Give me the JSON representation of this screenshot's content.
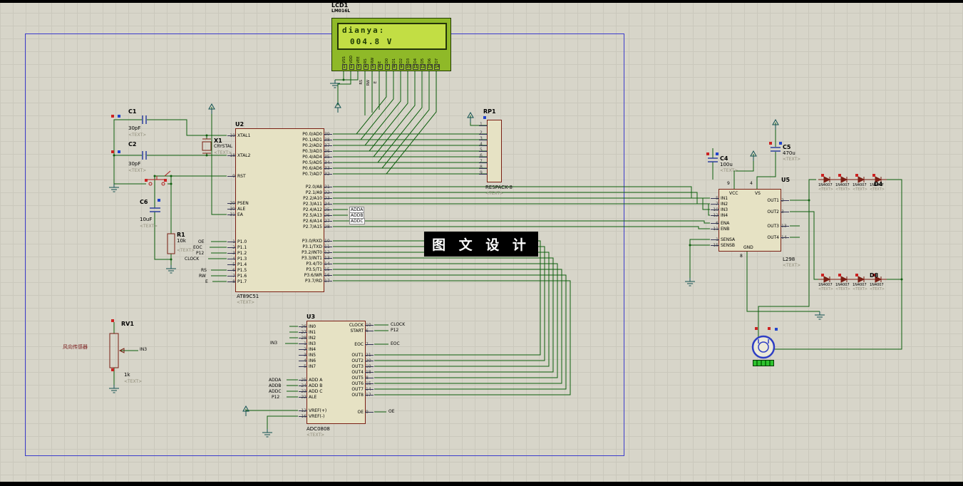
{
  "colors": {
    "wire": "#0d5e0d",
    "chip_fill": "#e6e2c4",
    "chip_border": "#7a1f14",
    "sheet_border": "#3c3ccc",
    "lcd_body": "#8fb928",
    "lcd_screen": "#c2de44",
    "lcd_text": "#1d3a04",
    "watermark_bg": "#000000",
    "watermark_text": "#ffffff",
    "sensor_text": "#7a1a1a",
    "readout": "#2ec22e"
  },
  "watermark": "图 文 设 计",
  "sensor_label": "风向传感器",
  "lcd": {
    "ref": "LCD1",
    "model": "LM016L",
    "line1": "dianya:",
    "line2": "004.8 V",
    "pins": [
      {
        "num": "1",
        "name": "VSS"
      },
      {
        "num": "2",
        "name": "VDD"
      },
      {
        "num": "3",
        "name": "VEE"
      },
      {
        "num": "4",
        "name": "RS"
      },
      {
        "num": "5",
        "name": "RW"
      },
      {
        "num": "6",
        "name": "E"
      },
      {
        "num": "7",
        "name": "D0"
      },
      {
        "num": "8",
        "name": "D1"
      },
      {
        "num": "9",
        "name": "D2"
      },
      {
        "num": "10",
        "name": "D3"
      },
      {
        "num": "11",
        "name": "D4"
      },
      {
        "num": "12",
        "name": "D5"
      },
      {
        "num": "13",
        "name": "D6"
      },
      {
        "num": "14",
        "name": "D7"
      }
    ]
  },
  "u2": {
    "ref": "U2",
    "value": "AT89C51",
    "ph": "<TEXT>",
    "g_xtal1": [
      {
        "num": "19",
        "name": "XTAL1"
      }
    ],
    "g_xtal2": [
      {
        "num": "18",
        "name": "XTAL2"
      }
    ],
    "g_rst": [
      {
        "num": "9",
        "name": "RST"
      }
    ],
    "g_ctrl": [
      {
        "num": "29",
        "name": "PSEN"
      },
      {
        "num": "30",
        "name": "ALE"
      },
      {
        "num": "31",
        "name": "EA"
      }
    ],
    "g_p1": [
      {
        "num": "1",
        "name": "P1.0"
      },
      {
        "num": "2",
        "name": "P1.1"
      },
      {
        "num": "3",
        "name": "P1.2"
      },
      {
        "num": "4",
        "name": "P1.3"
      },
      {
        "num": "5",
        "name": "P1.4"
      },
      {
        "num": "6",
        "name": "P1.5"
      },
      {
        "num": "7",
        "name": "P1.6"
      },
      {
        "num": "8",
        "name": "P1.7"
      }
    ],
    "g_p0": [
      {
        "num": "39",
        "name": "P0.0/AD0"
      },
      {
        "num": "38",
        "name": "P0.1/AD1"
      },
      {
        "num": "37",
        "name": "P0.2/AD2"
      },
      {
        "num": "36",
        "name": "P0.3/AD3"
      },
      {
        "num": "35",
        "name": "P0.4/AD4"
      },
      {
        "num": "34",
        "name": "P0.5/AD5"
      },
      {
        "num": "33",
        "name": "P0.6/AD6"
      },
      {
        "num": "32",
        "name": "P0.7/AD7"
      }
    ],
    "g_p2": [
      {
        "num": "21",
        "name": "P2.0/A8"
      },
      {
        "num": "22",
        "name": "P2.1/A9"
      },
      {
        "num": "23",
        "name": "P2.2/A10"
      },
      {
        "num": "24",
        "name": "P2.3/A11"
      },
      {
        "num": "25",
        "name": "P2.4/A12"
      },
      {
        "num": "26",
        "name": "P2.5/A13"
      },
      {
        "num": "27",
        "name": "P2.6/A14"
      },
      {
        "num": "28",
        "name": "P2.7/A15"
      }
    ],
    "g_p3": [
      {
        "num": "10",
        "name": "P3.0/RXD"
      },
      {
        "num": "11",
        "name": "P3.1/TXD"
      },
      {
        "num": "12",
        "name": "P3.2/INT0"
      },
      {
        "num": "13",
        "name": "P3.3/INT1"
      },
      {
        "num": "14",
        "name": "P3.4/T0"
      },
      {
        "num": "15",
        "name": "P3.5/T1"
      },
      {
        "num": "16",
        "name": "P3.6/WR"
      },
      {
        "num": "17",
        "name": "P3.7/RD"
      }
    ]
  },
  "u3": {
    "ref": "U3",
    "value": "ADC0808",
    "ph": "<TEXT>",
    "g_in": [
      {
        "num": "26",
        "name": "IN0"
      },
      {
        "num": "27",
        "name": "IN1"
      },
      {
        "num": "28",
        "name": "IN2"
      },
      {
        "num": "1",
        "name": "IN3"
      },
      {
        "num": "2",
        "name": "IN4"
      },
      {
        "num": "3",
        "name": "IN5"
      },
      {
        "num": "4",
        "name": "IN6"
      },
      {
        "num": "5",
        "name": "IN7"
      }
    ],
    "g_addr": [
      {
        "num": "25",
        "name": "ADD A"
      },
      {
        "num": "24",
        "name": "ADD B"
      },
      {
        "num": "23",
        "name": "ADD C"
      },
      {
        "num": "22",
        "name": "ALE"
      }
    ],
    "g_vref": [
      {
        "num": "12",
        "name": "VREF(+)"
      },
      {
        "num": "16",
        "name": "VREF(-)"
      }
    ],
    "g_clk": [
      {
        "num": "10",
        "name": "CLOCK"
      },
      {
        "num": "6",
        "name": "START"
      }
    ],
    "g_eoc": [
      {
        "num": "7",
        "name": "EOC"
      }
    ],
    "g_out": [
      {
        "num": "21",
        "name": "OUT1"
      },
      {
        "num": "20",
        "name": "OUT2"
      },
      {
        "num": "19",
        "name": "OUT3"
      },
      {
        "num": "18",
        "name": "OUT4"
      },
      {
        "num": "8",
        "name": "OUT5"
      },
      {
        "num": "15",
        "name": "OUT6"
      },
      {
        "num": "14",
        "name": "OUT7"
      },
      {
        "num": "17",
        "name": "OUT8"
      }
    ],
    "g_oe": [
      {
        "num": "9",
        "name": "OE"
      }
    ]
  },
  "u5": {
    "ref": "U5",
    "value": "L298",
    "ph": "<TEXT>",
    "vcc": "VCC",
    "vs": "VS",
    "gnd": "GND",
    "vcc_num": "9",
    "vs_num": "4",
    "gnd_num": "8",
    "g_in": [
      {
        "num": "5",
        "name": "IN1"
      },
      {
        "num": "7",
        "name": "IN2"
      },
      {
        "num": "10",
        "name": "IN3"
      },
      {
        "num": "12",
        "name": "IN4"
      }
    ],
    "g_en": [
      {
        "num": "6",
        "name": "ENA"
      },
      {
        "num": "11",
        "name": "ENB"
      }
    ],
    "g_sens": [
      {
        "num": "1",
        "name": "SENSA"
      },
      {
        "num": "15",
        "name": "SENSB"
      }
    ],
    "g_o1": [
      {
        "num": "2",
        "name": "OUT1"
      }
    ],
    "g_o2": [
      {
        "num": "3",
        "name": "OUT2"
      }
    ],
    "g_o3": [
      {
        "num": "13",
        "name": "OUT3"
      }
    ],
    "g_o4": [
      {
        "num": "14",
        "name": "OUT4"
      }
    ]
  },
  "rp1": {
    "ref": "RP1",
    "value": "RESPACK-8",
    "ph": "<TEXT>",
    "g_top": [
      "1"
    ],
    "g_pins": [
      "2",
      "3",
      "4",
      "5",
      "6",
      "7",
      "8",
      "9"
    ]
  },
  "parts": {
    "c1": {
      "ref": "C1",
      "value": "30pF",
      "ph": "<TEXT>"
    },
    "c2": {
      "ref": "C2",
      "value": "30pF",
      "ph": "<TEXT>"
    },
    "c4": {
      "ref": "C4",
      "value": "100u",
      "ph": "<TEXT>"
    },
    "c5": {
      "ref": "C5",
      "value": "470u",
      "ph": "<TEXT>"
    },
    "c6": {
      "ref": "C6",
      "value": "10uF",
      "ph": "<TEXT>"
    },
    "r1": {
      "ref": "R1",
      "value": "10k",
      "ph": "<TEXT>"
    },
    "rv1": {
      "ref": "RV1",
      "value": "1k",
      "ph": "<TEXT>"
    },
    "x1": {
      "ref": "X1",
      "value": "CRYSTAL",
      "ph": "<TEXT>"
    },
    "d4": {
      "ref": "D4",
      "items": [
        {
          "v": "1N4007",
          "t": "<TEXT>"
        },
        {
          "v": "1N4007",
          "t": "<TEXT>"
        },
        {
          "v": "1N4007",
          "t": "<TEXT>"
        },
        {
          "v": "1N4007",
          "t": "<TEXT>"
        }
      ]
    },
    "d8": {
      "ref": "D8",
      "items": [
        {
          "v": "1N4007",
          "t": "<TEXT>"
        },
        {
          "v": "1N4007",
          "t": "<TEXT>"
        },
        {
          "v": "1N4007",
          "t": "<TEXT>"
        },
        {
          "v": "1N4007",
          "t": "<TEXT>"
        }
      ]
    }
  },
  "labels": {
    "oe": "OE",
    "eoc": "EOC",
    "p12": "P12",
    "clock": "CLOCK",
    "rs": "RS",
    "rw": "RW",
    "e": "E",
    "adda": "ADDA",
    "addb": "ADDB",
    "addc": "ADDC",
    "in3": "IN3"
  }
}
